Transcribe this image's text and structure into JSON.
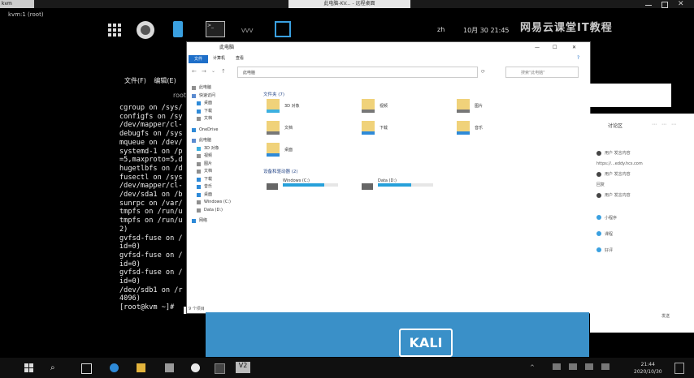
{
  "titlebar": {
    "tab": "kvm",
    "window_label": "kvm:1 (root)",
    "center_title": "此电脑-KV... - 远程桌面"
  },
  "kali_panel": {
    "language": "zh",
    "datetime": "10月 30 21:45",
    "watermark": "网易云课堂IT教程"
  },
  "terminal": {
    "menu": [
      "文件(F)",
      "编辑(E)"
    ],
    "header": "root",
    "lines": [
      "cgroup on /sys/",
      "configfs on /sy",
      "/dev/mapper/cl-",
      "debugfs on /sys",
      "mqueue on /dev/",
      "systemd-1 on /p",
      "=5,maxproto=5,d",
      "hugetlbfs on /d",
      "fusectl on /sys",
      "/dev/mapper/cl-",
      "/dev/sda1 on /b",
      "sunrpc on /var/",
      "tmpfs on /run/u",
      "tmpfs on /run/u",
      "2)",
      "gvfsd-fuse on /",
      "id=0)",
      "gvfsd-fuse on /",
      "id=0)",
      "gvfsd-fuse on /",
      "id=0)",
      "/dev/sdb1 on /r",
      "4096)",
      "[root@kvm ~]# "
    ]
  },
  "explorer": {
    "title": "此电脑",
    "ribbon_file": "文件",
    "ribbon_tabs": [
      "计算机",
      "查看"
    ],
    "address": "此电脑",
    "search_placeholder": "搜索\"此电脑\"",
    "nav_header": "此电脑",
    "nav": [
      {
        "label": "快速访问",
        "color": "#5b8bd0"
      },
      {
        "label": "桌面",
        "color": "#2e8ad8"
      },
      {
        "label": "下载",
        "color": "#2e8ad8"
      },
      {
        "label": "文档",
        "color": "#8f8f8f"
      },
      {
        "label": "OneDrive",
        "color": "#2e8ad8"
      },
      {
        "label": "此电脑",
        "color": "#5b8bd0"
      },
      {
        "label": "3D 对象",
        "color": "#3cb0e0"
      },
      {
        "label": "视频",
        "color": "#8f8f8f"
      },
      {
        "label": "图片",
        "color": "#8f8f8f"
      },
      {
        "label": "文档",
        "color": "#8f8f8f"
      },
      {
        "label": "下载",
        "color": "#2e8ad8"
      },
      {
        "label": "音乐",
        "color": "#2e8ad8"
      },
      {
        "label": "桌面",
        "color": "#2e8ad8"
      },
      {
        "label": "Windows (C:)",
        "color": "#8f8f8f"
      },
      {
        "label": "Data (D:)",
        "color": "#8f8f8f"
      },
      {
        "label": "网络",
        "color": "#2e8ad8"
      }
    ],
    "folders_header": "文件夹 (7)",
    "folders": [
      "3D 对象",
      "视频",
      "图片",
      "文档",
      "下载",
      "音乐",
      "桌面"
    ],
    "drives_header": "设备和驱动器 (2)",
    "drives": [
      {
        "label": "Windows (C:)",
        "used_fraction": 0.75
      },
      {
        "label": "Data (D:)",
        "used_fraction": 0.6
      }
    ],
    "status": "9 个项目"
  },
  "chat": {
    "title": "讨论区",
    "messages": [
      "用户 发言内容",
      "https://...eddy.hcs.com",
      "用户 发言内容",
      "回复",
      "用户 发言内容"
    ],
    "sidebar_items": [
      "小程序",
      "课程",
      "好评"
    ],
    "footer": "发送"
  },
  "banner": {
    "logo_text": "KALI"
  },
  "taskbar": {
    "time": "21:44",
    "date": "2020/10/30"
  }
}
